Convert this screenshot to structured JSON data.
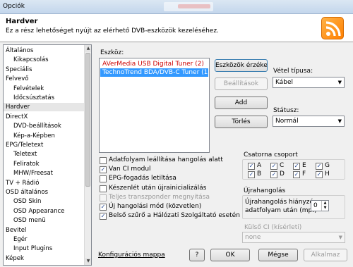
{
  "window": {
    "title": "Opciók"
  },
  "header": {
    "title": "Hardver",
    "description": "Ez a rész lehetőséget nyújt az elérhető DVB-eszközök kezeléséhez.",
    "icon": "rss-icon"
  },
  "sidebar": {
    "items": [
      {
        "label": "Általános",
        "level": 0
      },
      {
        "label": "Kikapcsolás",
        "level": 1
      },
      {
        "label": "Speciális",
        "level": 0
      },
      {
        "label": "Felvevő",
        "level": 0
      },
      {
        "label": "Felvételek",
        "level": 1
      },
      {
        "label": "Időcsúsztatás",
        "level": 1
      },
      {
        "label": "Hardver",
        "level": 0,
        "selected": true
      },
      {
        "label": "DirectX",
        "level": 0
      },
      {
        "label": "DVD-beállítások",
        "level": 1
      },
      {
        "label": "Kép-a-Képben",
        "level": 1
      },
      {
        "label": "EPG/Teletext",
        "level": 0
      },
      {
        "label": "Teletext",
        "level": 1
      },
      {
        "label": "Feliratok",
        "level": 1
      },
      {
        "label": "MHW/Freesat",
        "level": 1
      },
      {
        "label": "TV + Rádió",
        "level": 0
      },
      {
        "label": "OSD általános",
        "level": 0
      },
      {
        "label": "OSD Skin",
        "level": 1
      },
      {
        "label": "OSD Appearance",
        "level": 1
      },
      {
        "label": "OSD menü",
        "level": 1
      },
      {
        "label": "Bevitel",
        "level": 0
      },
      {
        "label": "Egér",
        "level": 1
      },
      {
        "label": "Input Plugins",
        "level": 1
      },
      {
        "label": "Képek",
        "level": 0
      }
    ]
  },
  "devices": {
    "label": "Eszköz:",
    "items": [
      {
        "label": "AVerMedia USB Digital Tuner (2)",
        "color": "#cc0000"
      },
      {
        "label": "TechnoTrend BDA/DVB-C Tuner (1)",
        "selected": true
      }
    ]
  },
  "buttons": {
    "detect": "Eszközök érzékelése",
    "settings": "Beállítások",
    "add": "Add",
    "delete": "Törlés"
  },
  "reception": {
    "label": "Vétel típusa:",
    "value": "Kábel"
  },
  "status": {
    "label": "Státusz:",
    "value": "Normál"
  },
  "checkboxes": [
    {
      "label": "Adatfolyam leállítása hangolás alatt",
      "checked": false,
      "enabled": true
    },
    {
      "label": "Van CI modul",
      "checked": true,
      "enabled": true
    },
    {
      "label": "EPG-fogadás letiltása",
      "checked": false,
      "enabled": true
    },
    {
      "label": "Készenlét után újrainicializálás",
      "checked": false,
      "enabled": true
    },
    {
      "label": "Teljes transzponder megnyitása",
      "checked": false,
      "enabled": false
    },
    {
      "label": "Új hangolási mód (közvetlen)",
      "checked": true,
      "enabled": true
    },
    {
      "label": "Belső szűrő a Hálózati Szolgáltató esetén",
      "checked": true,
      "enabled": true
    }
  ],
  "channel_group": {
    "label": "Csatorna csoport",
    "items": [
      {
        "label": "A",
        "checked": true
      },
      {
        "label": "C",
        "checked": true
      },
      {
        "label": "E",
        "checked": true
      },
      {
        "label": "G",
        "checked": true
      },
      {
        "label": "B",
        "checked": true
      },
      {
        "label": "D",
        "checked": true
      },
      {
        "label": "F",
        "checked": true
      },
      {
        "label": "H",
        "checked": true
      }
    ]
  },
  "retune": {
    "label": "Újrahangolás",
    "field_label_1": "Újrahangolás hiányzó",
    "field_label_2": "adatfolyam után (mp.)",
    "value": "0"
  },
  "external_ci": {
    "label": "Külső CI (kísérleti)",
    "value": "none"
  },
  "footer": {
    "config_link": "Konfigurációs mappa",
    "help": "?",
    "ok": "OK",
    "cancel": "Mégse",
    "apply": "Alkalmaz"
  },
  "colors": {
    "accent": "#3399ff",
    "header_bg": "#ffffff",
    "rss": "#ff8c00"
  }
}
